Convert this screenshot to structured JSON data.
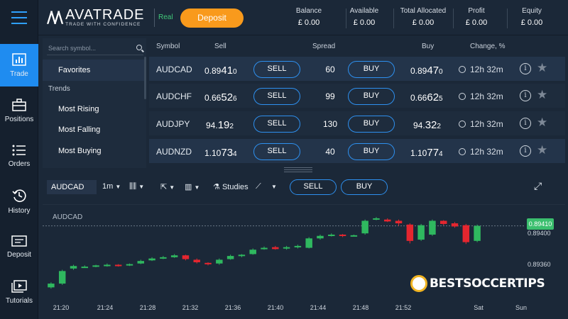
{
  "colors": {
    "accent": "#1f8cf0",
    "deposit": "#f99a1c",
    "bull": "#2fb85f",
    "bear": "#e5262f",
    "real": "#41c979"
  },
  "nav": {
    "menu_icon": "hamburger-icon",
    "items": [
      {
        "label": "Trade",
        "icon": "bar-chart-icon"
      },
      {
        "label": "Positions",
        "icon": "briefcase-icon"
      },
      {
        "label": "Orders",
        "icon": "list-icon"
      },
      {
        "label": "History",
        "icon": "history-icon"
      },
      {
        "label": "Deposit",
        "icon": "money-icon"
      },
      {
        "label": "Tutorials",
        "icon": "tutorials-icon"
      }
    ]
  },
  "header": {
    "brand": "AVATRADE",
    "tagline": "TRADE WITH CONFIDENCE",
    "account_type": "Real",
    "deposit_label": "Deposit",
    "stats": [
      {
        "label": "Balance",
        "value": "£ 0.00"
      },
      {
        "label": "Available",
        "value": "£ 0.00"
      },
      {
        "label": "Total Allocated",
        "value": "£ 0.00"
      },
      {
        "label": "Profit",
        "value": "£ 0.00"
      },
      {
        "label": "Equity",
        "value": "£ 0.00"
      }
    ]
  },
  "sidebar": {
    "search_placeholder": "Search symbol...",
    "items": [
      {
        "label": "Favorites",
        "kind": "item"
      },
      {
        "label": "Trends",
        "kind": "header"
      },
      {
        "label": "Most Rising",
        "kind": "item"
      },
      {
        "label": "Most Falling",
        "kind": "item"
      },
      {
        "label": "Most Buying",
        "kind": "item"
      }
    ]
  },
  "table": {
    "columns": [
      "Symbol",
      "Sell",
      "Spread",
      "Buy",
      "Change, %"
    ],
    "sell_label": "SELL",
    "buy_label": "BUY",
    "rows": [
      {
        "symbol": "AUDCAD",
        "sell": [
          "0.89",
          "41",
          "0"
        ],
        "spread": "60",
        "buy": [
          "0.89",
          "47",
          "0"
        ],
        "change": "12h 32m"
      },
      {
        "symbol": "AUDCHF",
        "sell": [
          "0.66",
          "52",
          "6"
        ],
        "spread": "99",
        "buy": [
          "0.66",
          "62",
          "5"
        ],
        "change": "12h 32m"
      },
      {
        "symbol": "AUDJPY",
        "sell": [
          "94.",
          "19",
          "2"
        ],
        "spread": "130",
        "buy": [
          "94.",
          "32",
          "2"
        ],
        "change": "12h 32m"
      },
      {
        "symbol": "AUDNZD",
        "sell": [
          "1.10",
          "73",
          "4"
        ],
        "spread": "40",
        "buy": [
          "1.10",
          "77",
          "4"
        ],
        "change": "12h 32m"
      }
    ]
  },
  "chart_toolbar": {
    "symbol": "AUDCAD",
    "timeframe": "1m",
    "studies": "Studies",
    "sell_label": "SELL",
    "buy_label": "BUY"
  },
  "chart_data": {
    "type": "candlestick",
    "symbol": "AUDCAD",
    "current_price": "0.89410",
    "y_ticks": [
      "0.89400",
      "0.89360"
    ],
    "x_ticks": [
      "21:20",
      "21:24",
      "21:28",
      "21:32",
      "21:36",
      "21:40",
      "21:44",
      "21:48",
      "21:52",
      "Sat",
      "Sun"
    ],
    "ylim": [
      0.893,
      0.8944
    ],
    "candles": [
      {
        "o": 0.89312,
        "c": 0.89318,
        "h": 0.8932,
        "l": 0.8931
      },
      {
        "o": 0.89318,
        "c": 0.89338,
        "h": 0.8934,
        "l": 0.89316
      },
      {
        "o": 0.89342,
        "c": 0.89346,
        "h": 0.89348,
        "l": 0.8934
      },
      {
        "o": 0.89344,
        "c": 0.89345,
        "h": 0.89347,
        "l": 0.89343
      },
      {
        "o": 0.89345,
        "c": 0.89347,
        "h": 0.89348,
        "l": 0.89344
      },
      {
        "o": 0.89346,
        "c": 0.89348,
        "h": 0.8935,
        "l": 0.89345
      },
      {
        "o": 0.89348,
        "c": 0.89347,
        "h": 0.89349,
        "l": 0.89345
      },
      {
        "o": 0.89347,
        "c": 0.89349,
        "h": 0.8935,
        "l": 0.89346
      },
      {
        "o": 0.8935,
        "c": 0.89354,
        "h": 0.89356,
        "l": 0.89349
      },
      {
        "o": 0.89355,
        "c": 0.89358,
        "h": 0.8936,
        "l": 0.89354
      },
      {
        "o": 0.89358,
        "c": 0.8936,
        "h": 0.89362,
        "l": 0.89357
      },
      {
        "o": 0.8936,
        "c": 0.89363,
        "h": 0.89365,
        "l": 0.89359
      },
      {
        "o": 0.89363,
        "c": 0.89357,
        "h": 0.89364,
        "l": 0.89355
      },
      {
        "o": 0.89356,
        "c": 0.89352,
        "h": 0.89358,
        "l": 0.8935
      },
      {
        "o": 0.89351,
        "c": 0.89349,
        "h": 0.89352,
        "l": 0.89347
      },
      {
        "o": 0.8935,
        "c": 0.89356,
        "h": 0.89358,
        "l": 0.89348
      },
      {
        "o": 0.89357,
        "c": 0.89362,
        "h": 0.89364,
        "l": 0.89356
      },
      {
        "o": 0.89362,
        "c": 0.89364,
        "h": 0.89365,
        "l": 0.8936
      },
      {
        "o": 0.89365,
        "c": 0.89372,
        "h": 0.89374,
        "l": 0.89364
      },
      {
        "o": 0.89373,
        "c": 0.89375,
        "h": 0.89377,
        "l": 0.89372
      },
      {
        "o": 0.89376,
        "c": 0.89373,
        "h": 0.89378,
        "l": 0.89372
      },
      {
        "o": 0.89374,
        "c": 0.89376,
        "h": 0.89378,
        "l": 0.89372
      },
      {
        "o": 0.89376,
        "c": 0.89378,
        "h": 0.8938,
        "l": 0.89374
      },
      {
        "o": 0.89375,
        "c": 0.8939,
        "h": 0.89392,
        "l": 0.89374
      },
      {
        "o": 0.8939,
        "c": 0.89394,
        "h": 0.89396,
        "l": 0.89388
      },
      {
        "o": 0.89394,
        "c": 0.89396,
        "h": 0.89398,
        "l": 0.89393
      },
      {
        "o": 0.89396,
        "c": 0.89394,
        "h": 0.89397,
        "l": 0.89392
      },
      {
        "o": 0.89394,
        "c": 0.89395,
        "h": 0.89396,
        "l": 0.89393
      },
      {
        "o": 0.89398,
        "c": 0.89418,
        "h": 0.8942,
        "l": 0.89396
      },
      {
        "o": 0.8942,
        "c": 0.89422,
        "h": 0.89424,
        "l": 0.89419
      },
      {
        "o": 0.8942,
        "c": 0.89417,
        "h": 0.89422,
        "l": 0.89416
      },
      {
        "o": 0.89418,
        "c": 0.89414,
        "h": 0.8942,
        "l": 0.8941
      },
      {
        "o": 0.89412,
        "c": 0.89386,
        "h": 0.89414,
        "l": 0.89382
      },
      {
        "o": 0.89388,
        "c": 0.89411,
        "h": 0.89413,
        "l": 0.89386
      },
      {
        "o": 0.89396,
        "c": 0.89418,
        "h": 0.8942,
        "l": 0.89394
      },
      {
        "o": 0.89418,
        "c": 0.89413,
        "h": 0.89419,
        "l": 0.89411
      },
      {
        "o": 0.89414,
        "c": 0.89409,
        "h": 0.89416,
        "l": 0.89407
      },
      {
        "o": 0.89411,
        "c": 0.89384,
        "h": 0.89413,
        "l": 0.89381
      },
      {
        "o": 0.89386,
        "c": 0.8941,
        "h": 0.89412,
        "l": 0.89384
      }
    ]
  },
  "watermark": {
    "text": "BESTSOCCERTIPS"
  }
}
